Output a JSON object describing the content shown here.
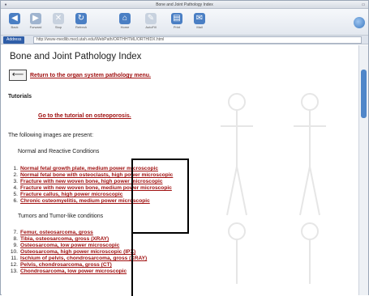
{
  "window": {
    "title": "Bone and Joint Pathology Index"
  },
  "toolbar": {
    "buttons": [
      {
        "label": "Back",
        "icon": "back-arrow-icon",
        "color": "#4a7fc4"
      },
      {
        "label": "Forward",
        "icon": "forward-arrow-icon",
        "color": "#9fb4cf"
      },
      {
        "label": "Stop",
        "icon": "stop-icon",
        "color": "#c8d2df"
      },
      {
        "label": "Refresh",
        "icon": "refresh-icon",
        "color": "#4a7fc4"
      },
      {
        "label": "Home",
        "icon": "home-icon",
        "color": "#4a7fc4"
      },
      {
        "label": "AutoFill",
        "icon": "autofill-icon",
        "color": "#c8d2df"
      },
      {
        "label": "Print",
        "icon": "print-icon",
        "color": "#4a7fc4"
      },
      {
        "label": "Mail",
        "icon": "mail-icon",
        "color": "#4a7fc4"
      }
    ]
  },
  "address": {
    "label": "Address",
    "url": "http://www-medlib.med.utah.edu/WebPath/ORTHHTML/ORTHIDX.html"
  },
  "page": {
    "title": "Bone and Joint Pathology Index",
    "return_link": "Return to the organ system pathology menu.",
    "tutorials_heading": "Tutorials",
    "tutorial_link": "Go to the tutorial on osteoporosis.",
    "intro": "The following images are present:",
    "sections": [
      {
        "heading": "Normal and Reactive Conditions",
        "items": [
          "Normal fetal growth plate, medium power microscopic",
          "Normal fetal bone with osteoclasts, high power microscopic",
          "Fracture with new woven bone, high power microscopic",
          "Fracture with new woven bone, medium power microscopic",
          "Fracture callus, high power microscopic",
          "Chronic osteomyelitis, medium power microscopic"
        ]
      },
      {
        "heading": "Tumors and Tumor-like conditions",
        "items": [
          "Femur, osteosarcoma, gross",
          "Tibia, osteosarcoma, gross (XRAY)",
          "Osteosarcoma, low power microscopic",
          "Osteosarcoma, high power microscopic (IPX)",
          "Ischium of pelvis, chondrosarcoma, gross (XRAY)",
          "Pelvis, chondrosarcoma, gross (CT)",
          "Chondrosarcoma, low power microscopic"
        ]
      }
    ]
  },
  "colors": {
    "link": "#a01010",
    "address_label": "#2f5ea8",
    "scroll_thumb": "#4f86c9"
  }
}
